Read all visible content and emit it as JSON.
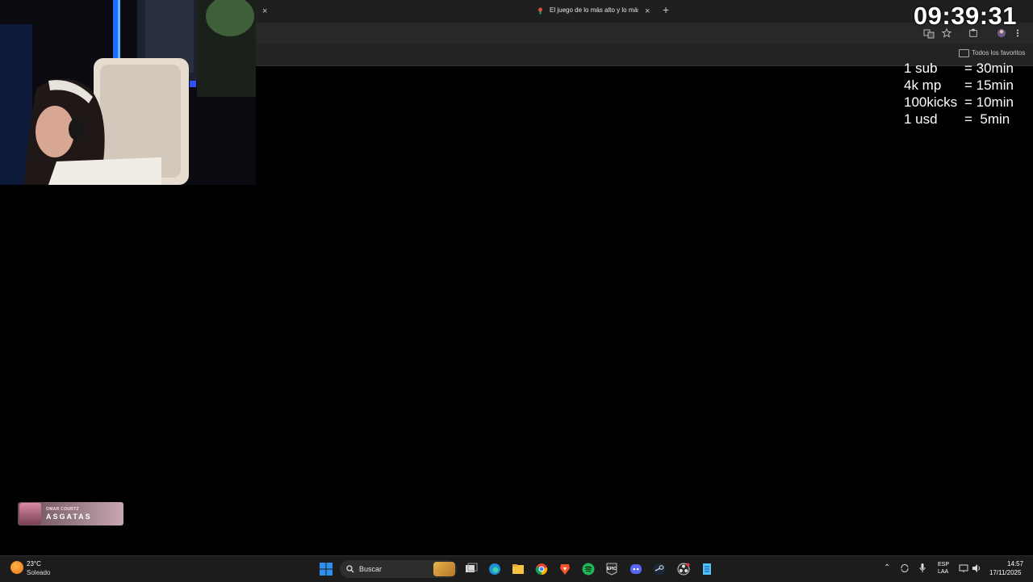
{
  "browser": {
    "tab_title": "El juego de lo más alto y lo más",
    "close_glyph": "×",
    "new_tab_glyph": "+",
    "bookmarks_label": "Todos los favoritos"
  },
  "overlay": {
    "timer": "09:39:31",
    "rates": [
      {
        "left": "1 sub",
        "right": "= 30min"
      },
      {
        "left": "4k mp",
        "right": "= 15min"
      },
      {
        "left": "100kicks",
        "right": "= 10min"
      },
      {
        "left": "1 usd",
        "right": "=  5min"
      }
    ],
    "alert_small": "OMAR COURTZ",
    "alert_big": "ASGATAS"
  },
  "taskbar": {
    "weather_temp": "23°C",
    "weather_desc": "Soleado",
    "search_placeholder": "Buscar",
    "lang_line1": "ESP",
    "lang_line2": "LAA",
    "clock_time": "14:57",
    "clock_date": "17/11/2025",
    "icons": [
      "windows-start-icon",
      "task-view-icon",
      "edge-icon",
      "file-explorer-icon",
      "chrome-icon",
      "brave-icon",
      "spotify-icon",
      "epic-games-icon",
      "discord-icon",
      "steam-icon",
      "obs-icon",
      "notepad-icon"
    ],
    "colors": {
      "accent": "#1db954",
      "windows_blue": "#2f8ff0"
    }
  }
}
